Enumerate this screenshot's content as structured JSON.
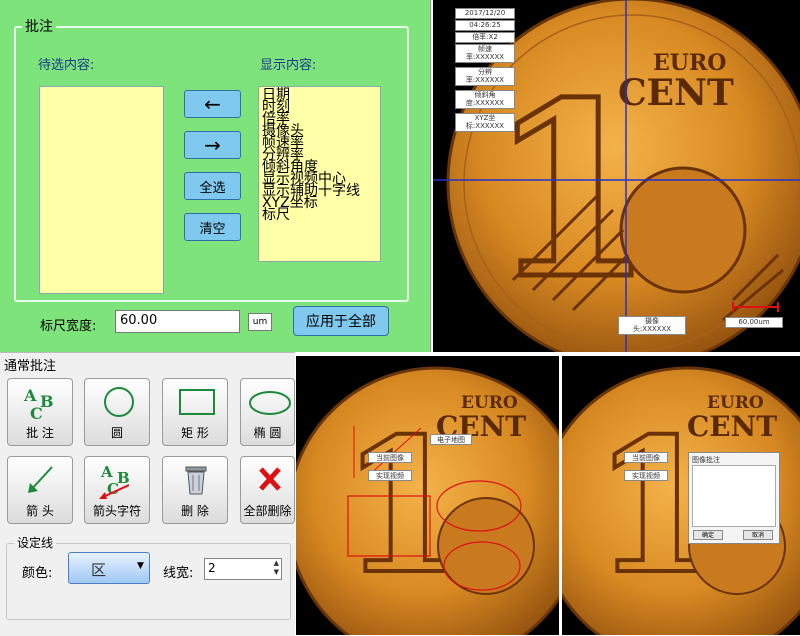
{
  "annotation_dialog": {
    "title": "批注",
    "pending_label": "待选内容:",
    "display_label": "显示内容:",
    "display_items": [
      "日期",
      "时刻",
      "倍率",
      "摄像头",
      "帧速率",
      "分辨率",
      "倾斜角度",
      "显示视频中心",
      "显示辅助十字线",
      "XYZ坐标",
      "标尺"
    ],
    "btn_left": "←",
    "btn_right": "→",
    "btn_select_all": "全选",
    "btn_clear": "清空",
    "ruler_label": "标尺宽度:",
    "ruler_value": "60.00",
    "unit": "um",
    "apply_label": "应用于全部"
  },
  "coin_view": {
    "info_boxes": [
      [
        "2017/12/20"
      ],
      [
        "04:26:25"
      ],
      [
        "倍率:X2"
      ],
      [
        "帧速",
        "率:XXXXXX"
      ],
      [
        "分辨",
        "率:XXXXXX"
      ],
      [
        "倾斜角",
        "度:XXXXXX"
      ],
      [
        "XYZ坐",
        "标:XXXXXX"
      ]
    ],
    "camera_tag": [
      "摄像",
      "头:XXXXXX"
    ],
    "scale_label": "60.00um",
    "coin_text_top": "EURO",
    "coin_text_bottom": "CENT",
    "coin_digit": "1",
    "crosshair_color": "#2233cc",
    "scale_color": "#dd1111"
  },
  "toolbar": {
    "title": "通常批注",
    "tools": [
      {
        "label": "批 注",
        "icon": "text-annotation-icon"
      },
      {
        "label": "圆",
        "icon": "circle-icon"
      },
      {
        "label": "矩 形",
        "icon": "rectangle-icon"
      },
      {
        "label": "椭 圆",
        "icon": "ellipse-icon"
      },
      {
        "label": "箭 头",
        "icon": "arrow-icon"
      },
      {
        "label": "箭头字符",
        "icon": "arrow-text-icon"
      },
      {
        "label": "删 除",
        "icon": "trash-icon"
      },
      {
        "label": "全部删除",
        "icon": "delete-all-icon"
      }
    ],
    "line_settings_title": "设定线",
    "color_label": "颜色:",
    "color_value": "区",
    "width_label": "线宽:",
    "width_value": "2"
  },
  "coin_small_1": {
    "tag_top": "电子地图",
    "tag_mid1": "当前图像",
    "tag_mid2": "实现视频",
    "coin_text_top": "EURO",
    "coin_text_bottom": "CENT",
    "coin_digit": "1"
  },
  "coin_small_2": {
    "tag_mid1": "当前图像",
    "tag_mid2": "实现视频",
    "dialog_title": "图像批注",
    "ok_label": "确定",
    "cancel_label": "取消",
    "coin_text_top": "EURO",
    "coin_text_bottom": "CENT",
    "coin_digit": "1"
  }
}
